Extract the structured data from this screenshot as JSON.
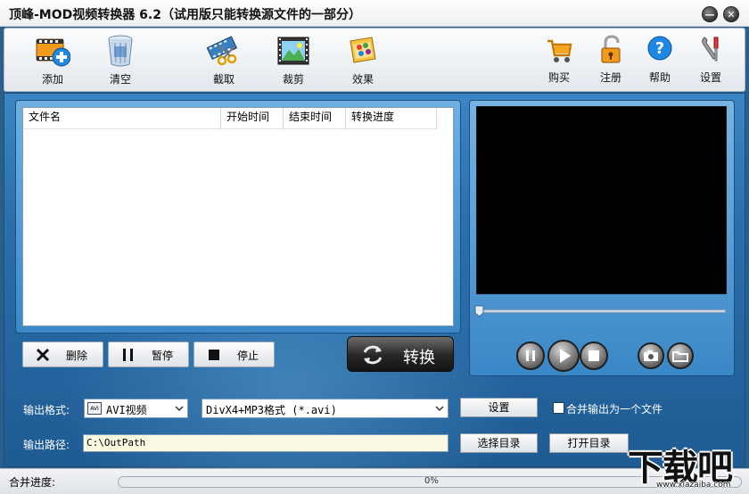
{
  "window": {
    "title": "顶峰-MOD视频转换器 6.2（试用版只能转换源文件的一部分）",
    "minimize_glyph": "—",
    "close_glyph": "✕"
  },
  "toolbar": {
    "add_label": "添加",
    "clear_label": "清空",
    "cut_label": "截取",
    "crop_label": "裁剪",
    "effect_label": "效果",
    "buy_label": "购买",
    "register_label": "注册",
    "help_label": "帮助",
    "settings_label": "设置"
  },
  "file_list": {
    "columns": [
      "文件名",
      "开始时间",
      "结束时间",
      "转换进度"
    ],
    "rows": []
  },
  "actions": {
    "delete_label": "删除",
    "pause_label": "暂停",
    "stop_label": "停止",
    "convert_label": "转换"
  },
  "player": {
    "seek_position": 0
  },
  "output": {
    "format_label": "输出格式:",
    "format_value": "AVI视频",
    "format_icon_text": "AVI",
    "codec_value": "DivX4+MP3格式 (*.avi)",
    "settings_button": "设置",
    "merge_label": "合并输出为一个文件",
    "merge_checked": false,
    "path_label": "输出路径:",
    "path_value": "C:\\OutPath",
    "choose_dir_button": "选择目录",
    "open_dir_button": "打开目录"
  },
  "status": {
    "merge_progress_label": "合并进度:",
    "progress_text": "0%",
    "progress_value": 0
  },
  "watermark": {
    "brand": "下载吧",
    "url": "www.xiazaiba.com"
  },
  "colors": {
    "panel_blue": "#2a6fac",
    "accent_blue": "#4a8ad0",
    "path_bg": "#fbf9e1"
  }
}
